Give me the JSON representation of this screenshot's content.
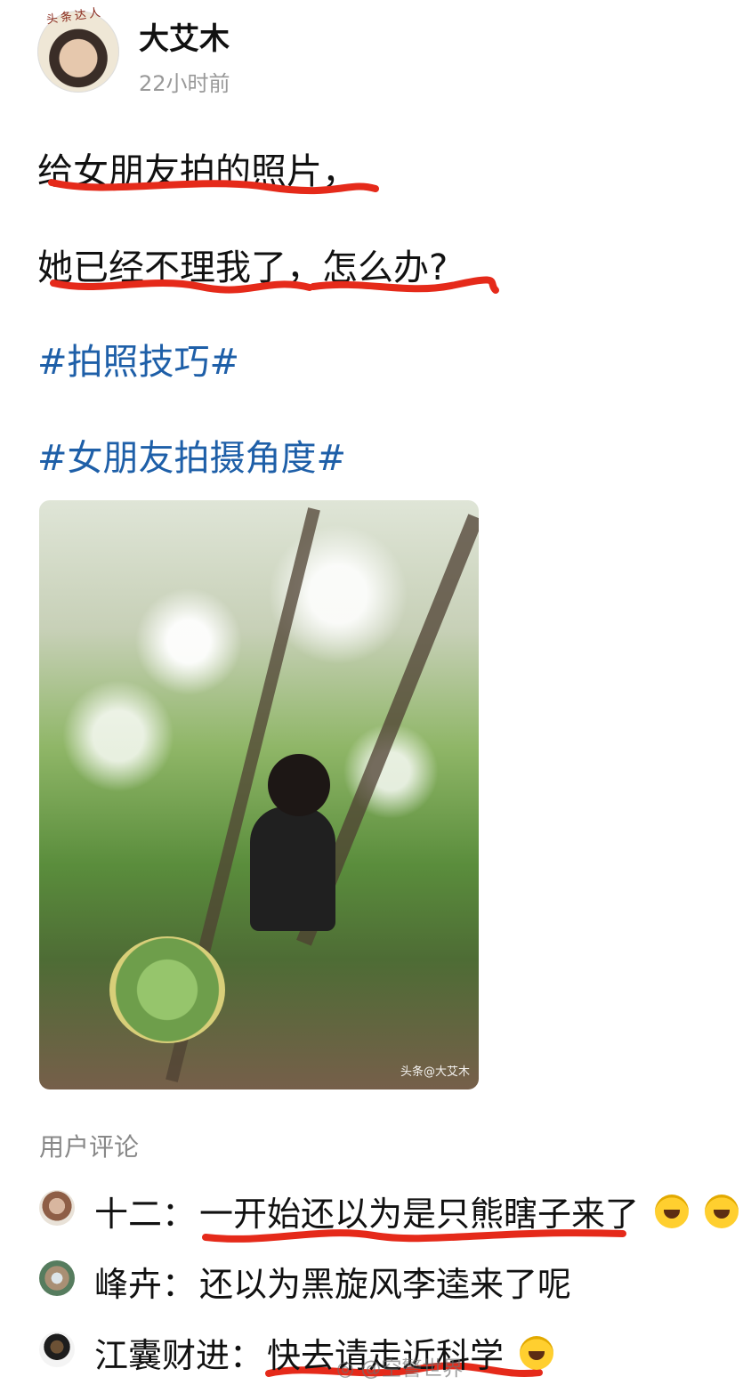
{
  "author": {
    "name": "大艾木",
    "time": "22小时前",
    "avatar_badge": "头条达人"
  },
  "post": {
    "line1": "给女朋友拍的照片，",
    "line2": "她已经不理我了，怎么办?",
    "hashtags": [
      "#拍照技巧#",
      "#女朋友拍摄角度#"
    ]
  },
  "photo": {
    "watermark": "头条@大艾木"
  },
  "comments_section": {
    "title": "用户评论",
    "items": [
      {
        "name": "十二：",
        "text": "一开始还以为是只熊瞎子来了",
        "emoji_count": 2
      },
      {
        "name": "峰卉：",
        "text": "还以为黑旋风李逵来了呢",
        "emoji_count": 0
      },
      {
        "name": "江囊财进：",
        "text": "快去请走近科学",
        "emoji_count": 1
      }
    ]
  },
  "footer_watermark": "@空警世界",
  "colors": {
    "hashtag": "#1e5fa8",
    "underline": "#e52a1a"
  },
  "icons": [
    "laughing-crying-emoji",
    "weibo-icon"
  ]
}
